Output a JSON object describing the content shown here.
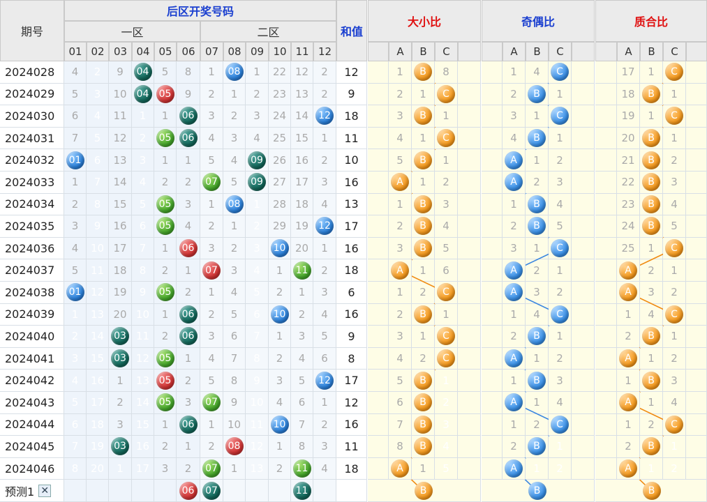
{
  "headers": {
    "period": "期号",
    "back_title": "后区开奖号码",
    "zone1": "一区",
    "zone2": "二区",
    "sum": "和值",
    "size_ratio": "大小比",
    "odd_even_ratio": "奇偶比",
    "prime_ratio": "质合比",
    "abc": [
      "A",
      "B",
      "C"
    ]
  },
  "number_cols": [
    "01",
    "02",
    "03",
    "04",
    "05",
    "06",
    "07",
    "08",
    "09",
    "10",
    "11",
    "12"
  ],
  "colors": {
    "header_bg": "#ebebeb",
    "title_blue": "#1a3fd0",
    "title_red": "#e01010"
  },
  "ball_colors": {
    "01": "blue",
    "02": "blue",
    "03": "teal",
    "04": "teal",
    "05": "green",
    "06": "teal",
    "07": "green",
    "08": "blue",
    "09": "teal",
    "10": "blue",
    "11": "green",
    "12": "blue"
  },
  "ball_red": {
    "2024029": [
      "05"
    ],
    "2024036": [
      "06"
    ],
    "2024037": [
      "07"
    ],
    "2024042": [
      "05"
    ],
    "2024045": [
      "08"
    ],
    "pred": [
      "06"
    ]
  },
  "rows": [
    {
      "period": "2024028",
      "cells": [
        "4",
        "2",
        "9",
        "04",
        "5",
        "8",
        "1",
        "08",
        "1",
        "22",
        "12",
        "2"
      ],
      "sum": "12",
      "dx": [
        "1",
        "B",
        "8"
      ],
      "jo": [
        "1",
        "4",
        "C"
      ],
      "zh": [
        "17",
        "1",
        "C"
      ]
    },
    {
      "period": "2024029",
      "cells": [
        "5",
        "3",
        "10",
        "04",
        "05",
        "9",
        "2",
        "1",
        "2",
        "23",
        "13",
        "2"
      ],
      "sum": "9",
      "dx": [
        "2",
        "1",
        "C"
      ],
      "jo": [
        "2",
        "B",
        "1"
      ],
      "zh": [
        "18",
        "B",
        "1"
      ]
    },
    {
      "period": "2024030",
      "cells": [
        "6",
        "4",
        "11",
        "1",
        "1",
        "06",
        "3",
        "2",
        "3",
        "24",
        "14",
        "12"
      ],
      "sum": "18",
      "dx": [
        "3",
        "B",
        "1"
      ],
      "jo": [
        "3",
        "1",
        "C"
      ],
      "zh": [
        "19",
        "1",
        "C"
      ]
    },
    {
      "period": "2024031",
      "cells": [
        "7",
        "5",
        "12",
        "2",
        "05",
        "06",
        "4",
        "3",
        "4",
        "25",
        "15",
        "1"
      ],
      "sum": "11",
      "dx": [
        "4",
        "1",
        "C"
      ],
      "jo": [
        "4",
        "B",
        "1"
      ],
      "zh": [
        "20",
        "B",
        "1"
      ]
    },
    {
      "period": "2024032",
      "cells": [
        "01",
        "6",
        "13",
        "3",
        "1",
        "1",
        "5",
        "4",
        "09",
        "26",
        "16",
        "2"
      ],
      "sum": "10",
      "dx": [
        "5",
        "B",
        "1"
      ],
      "jo": [
        "A",
        "1",
        "2"
      ],
      "zh": [
        "21",
        "B",
        "2"
      ]
    },
    {
      "period": "2024033",
      "cells": [
        "1",
        "7",
        "14",
        "4",
        "2",
        "2",
        "07",
        "5",
        "09",
        "27",
        "17",
        "3"
      ],
      "sum": "16",
      "dx": [
        "A",
        "1",
        "2"
      ],
      "jo": [
        "A",
        "2",
        "3"
      ],
      "zh": [
        "22",
        "B",
        "3"
      ]
    },
    {
      "period": "2024034",
      "cells": [
        "2",
        "8",
        "15",
        "5",
        "05",
        "3",
        "1",
        "08",
        "1",
        "28",
        "18",
        "4"
      ],
      "sum": "13",
      "dx": [
        "1",
        "B",
        "3"
      ],
      "jo": [
        "1",
        "B",
        "4"
      ],
      "zh": [
        "23",
        "B",
        "4"
      ]
    },
    {
      "period": "2024035",
      "cells": [
        "3",
        "9",
        "16",
        "6",
        "05",
        "4",
        "2",
        "1",
        "2",
        "29",
        "19",
        "12"
      ],
      "sum": "17",
      "dx": [
        "2",
        "B",
        "4"
      ],
      "jo": [
        "2",
        "B",
        "5"
      ],
      "zh": [
        "24",
        "B",
        "5"
      ]
    },
    {
      "period": "2024036",
      "cells": [
        "4",
        "10",
        "17",
        "7",
        "1",
        "06",
        "3",
        "2",
        "3",
        "10",
        "20",
        "1"
      ],
      "sum": "16",
      "dx": [
        "3",
        "B",
        "5"
      ],
      "jo": [
        "3",
        "1",
        "C"
      ],
      "zh": [
        "25",
        "1",
        "C"
      ]
    },
    {
      "period": "2024037",
      "cells": [
        "5",
        "11",
        "18",
        "8",
        "2",
        "1",
        "07",
        "3",
        "4",
        "1",
        "11",
        "2"
      ],
      "sum": "18",
      "dx": [
        "A",
        "1",
        "6"
      ],
      "jo": [
        "A",
        "2",
        "1"
      ],
      "zh": [
        "A",
        "2",
        "1"
      ]
    },
    {
      "period": "2024038",
      "cells": [
        "01",
        "12",
        "19",
        "9",
        "05",
        "2",
        "1",
        "4",
        "5",
        "2",
        "1",
        "3"
      ],
      "sum": "6",
      "dx": [
        "1",
        "2",
        "C"
      ],
      "jo": [
        "A",
        "3",
        "2"
      ],
      "zh": [
        "A",
        "3",
        "2"
      ]
    },
    {
      "period": "2024039",
      "cells": [
        "1",
        "13",
        "20",
        "10",
        "1",
        "06",
        "2",
        "5",
        "6",
        "10",
        "2",
        "4"
      ],
      "sum": "16",
      "dx": [
        "2",
        "B",
        "1"
      ],
      "jo": [
        "1",
        "4",
        "C"
      ],
      "zh": [
        "1",
        "4",
        "C"
      ]
    },
    {
      "period": "2024040",
      "cells": [
        "2",
        "14",
        "03",
        "11",
        "2",
        "06",
        "3",
        "6",
        "7",
        "1",
        "3",
        "5"
      ],
      "sum": "9",
      "dx": [
        "3",
        "1",
        "C"
      ],
      "jo": [
        "2",
        "B",
        "1"
      ],
      "zh": [
        "2",
        "B",
        "1"
      ]
    },
    {
      "period": "2024041",
      "cells": [
        "3",
        "15",
        "03",
        "12",
        "05",
        "1",
        "4",
        "7",
        "8",
        "2",
        "4",
        "6"
      ],
      "sum": "8",
      "dx": [
        "4",
        "2",
        "C"
      ],
      "jo": [
        "A",
        "1",
        "2"
      ],
      "zh": [
        "A",
        "1",
        "2"
      ]
    },
    {
      "period": "2024042",
      "cells": [
        "4",
        "16",
        "1",
        "13",
        "05",
        "2",
        "5",
        "8",
        "9",
        "3",
        "5",
        "12"
      ],
      "sum": "17",
      "dx": [
        "5",
        "B",
        "1"
      ],
      "jo": [
        "1",
        "B",
        "3"
      ],
      "zh": [
        "1",
        "B",
        "3"
      ]
    },
    {
      "period": "2024043",
      "cells": [
        "5",
        "17",
        "2",
        "14",
        "05",
        "3",
        "07",
        "9",
        "10",
        "4",
        "6",
        "1"
      ],
      "sum": "12",
      "dx": [
        "6",
        "B",
        "2"
      ],
      "jo": [
        "A",
        "1",
        "4"
      ],
      "zh": [
        "A",
        "1",
        "4"
      ]
    },
    {
      "period": "2024044",
      "cells": [
        "6",
        "18",
        "3",
        "15",
        "1",
        "06",
        "1",
        "10",
        "11",
        "10",
        "7",
        "2"
      ],
      "sum": "16",
      "dx": [
        "7",
        "B",
        "3"
      ],
      "jo": [
        "1",
        "2",
        "C"
      ],
      "zh": [
        "1",
        "2",
        "C"
      ]
    },
    {
      "period": "2024045",
      "cells": [
        "7",
        "19",
        "03",
        "16",
        "2",
        "1",
        "2",
        "08",
        "12",
        "1",
        "8",
        "3"
      ],
      "sum": "11",
      "dx": [
        "8",
        "B",
        "4"
      ],
      "jo": [
        "2",
        "B",
        "1"
      ],
      "zh": [
        "2",
        "B",
        "1"
      ]
    },
    {
      "period": "2024046",
      "cells": [
        "8",
        "20",
        "1",
        "17",
        "3",
        "2",
        "07",
        "1",
        "13",
        "2",
        "11",
        "4"
      ],
      "sum": "18",
      "dx": [
        "A",
        "1",
        "5"
      ],
      "jo": [
        "A",
        "1",
        "2"
      ],
      "zh": [
        "A",
        "1",
        "2"
      ]
    }
  ],
  "prediction": {
    "label": "预测1",
    "close": "✕",
    "balls": [
      "06",
      "07",
      "11"
    ],
    "dx": "B",
    "jo": "B",
    "zh": "B"
  }
}
